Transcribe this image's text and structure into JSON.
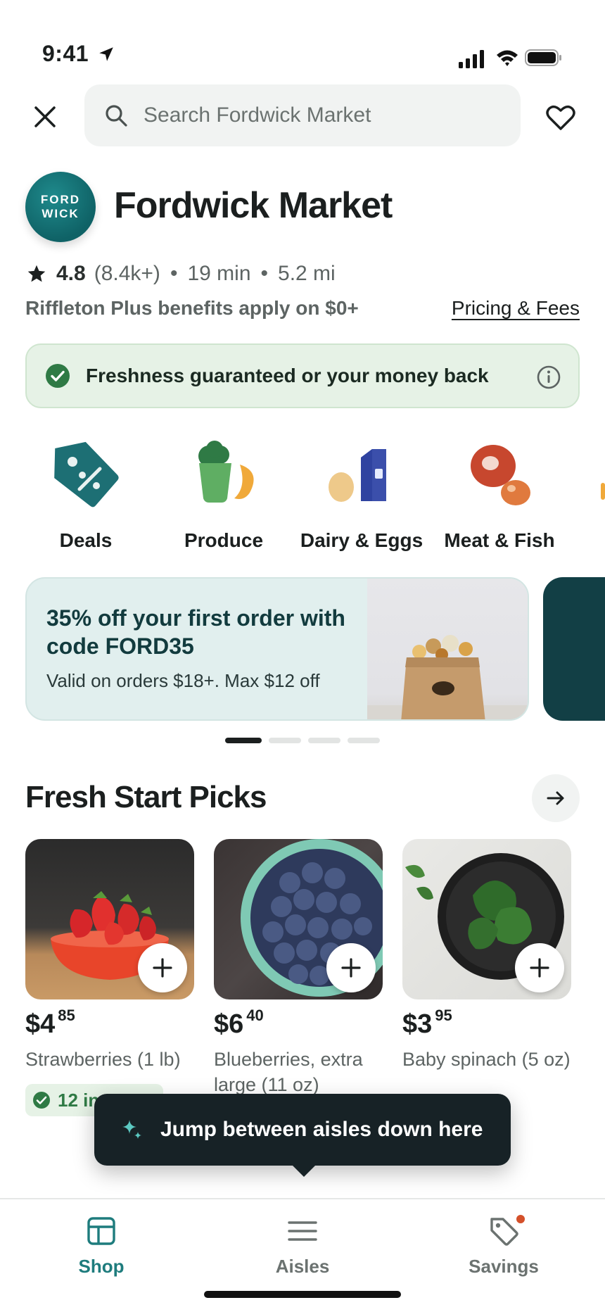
{
  "status_bar": {
    "time": "9:41"
  },
  "search": {
    "placeholder": "Search Fordwick Market"
  },
  "store": {
    "logo_line1": "FORD",
    "logo_line2": "WICK",
    "name": "Fordwick Market",
    "rating": "4.8",
    "reviews": "(8.4k+)",
    "eta": "19 min",
    "distance": "5.2 mi",
    "benefits": "Riffleton Plus benefits apply on $0+",
    "pricing_link": "Pricing & Fees"
  },
  "guarantee": {
    "text": "Freshness guaranteed or your money back"
  },
  "categories": [
    {
      "label": "Deals",
      "icon": "tag-icon"
    },
    {
      "label": "Produce",
      "icon": "produce-icon"
    },
    {
      "label": "Dairy & Eggs",
      "icon": "dairy-icon"
    },
    {
      "label": "Meat & Fish",
      "icon": "meat-icon"
    }
  ],
  "promo": {
    "title": "35% off your first order with code FORD35",
    "subtitle": "Valid on orders $18+. Max $12 off",
    "carousel_pages": 4,
    "active_page": 1
  },
  "picks": {
    "title": "Fresh Start Picks",
    "items": [
      {
        "dollars": "$4",
        "cents": "85",
        "name": "Strawberries (1 lb)"
      },
      {
        "dollars": "$6",
        "cents": "40",
        "name": "Blueberries, extra large (11 oz)"
      },
      {
        "dollars": "$3",
        "cents": "95",
        "name": "Baby spinach (5 oz)"
      }
    ],
    "stock_badge": "12 in"
  },
  "tooltip": {
    "text": "Jump between aisles down here"
  },
  "tabs": [
    {
      "label": "Shop",
      "icon": "shop-icon",
      "active": true
    },
    {
      "label": "Aisles",
      "icon": "aisles-icon",
      "active": false
    },
    {
      "label": "Savings",
      "icon": "savings-tag-icon",
      "active": false
    }
  ],
  "colors": {
    "accent": "#1e7c7d",
    "guarantee_bg": "#e6f2e6",
    "promo_bg": "#e1efee",
    "tooltip_bg": "#172226",
    "notification": "#d4502a"
  }
}
